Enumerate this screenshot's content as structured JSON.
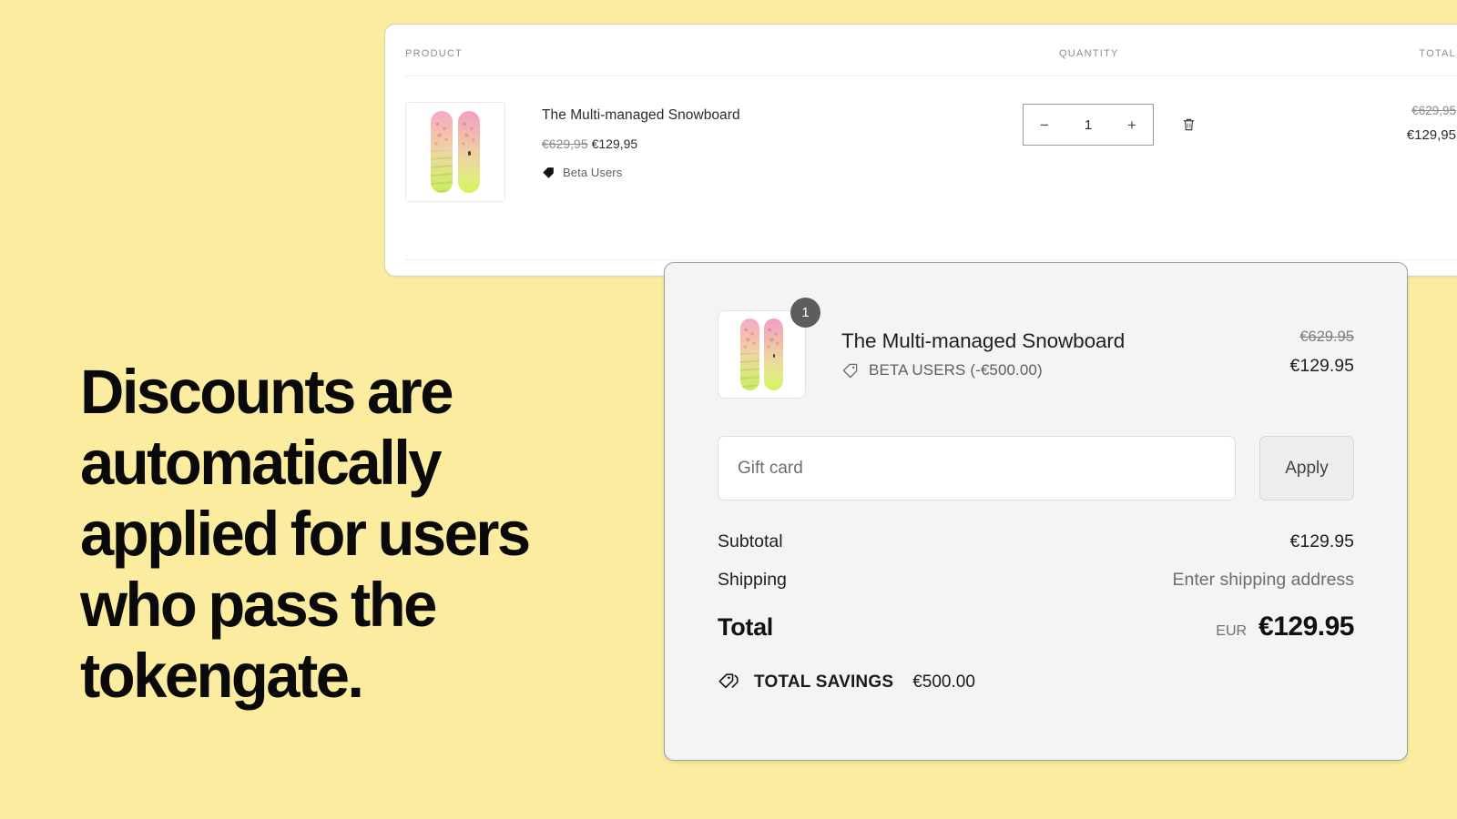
{
  "theme": {
    "background": "#fbeca0",
    "cart_panel_bg": "#ffffff",
    "checkout_panel_bg": "#f4f4f4",
    "badge_bg": "#5d5d5d",
    "text_primary": "#1f1f1f",
    "text_muted": "#6e6e6e"
  },
  "headline": {
    "text": "Discounts are automatically applied for users who pass the tokengate."
  },
  "cart": {
    "columns": {
      "product": "PRODUCT",
      "quantity": "QUANTITY",
      "total": "TOTAL"
    },
    "item": {
      "title": "The Multi-managed Snowboard",
      "price_original": "€629,95",
      "price_discounted": "€129,95",
      "discount_tag": "Beta Users",
      "quantity": "1",
      "decrease_symbol": "−",
      "increase_symbol": "+",
      "remove_label": "Remove item",
      "line_total_original": "€629,95",
      "line_total_discounted": "€129,95"
    }
  },
  "checkout": {
    "item": {
      "quantity_badge": "1",
      "title": "The Multi-managed Snowboard",
      "discount_label": "BETA USERS (-€500.00)",
      "price_original": "€629.95",
      "price_discounted": "€129.95"
    },
    "giftcard": {
      "placeholder": "Gift card",
      "value": "",
      "apply_label": "Apply"
    },
    "summary": {
      "subtotal_label": "Subtotal",
      "subtotal_value": "€129.95",
      "shipping_label": "Shipping",
      "shipping_value": "Enter shipping address",
      "total_label": "Total",
      "total_currency": "EUR",
      "total_value": "€129.95",
      "savings_label": "TOTAL SAVINGS",
      "savings_value": "€500.00"
    }
  },
  "icons": {
    "tag_filled": "tag-icon",
    "tag_outline": "tag-outline-icon",
    "tags_double": "tags-double-icon",
    "trash": "trash-icon"
  }
}
